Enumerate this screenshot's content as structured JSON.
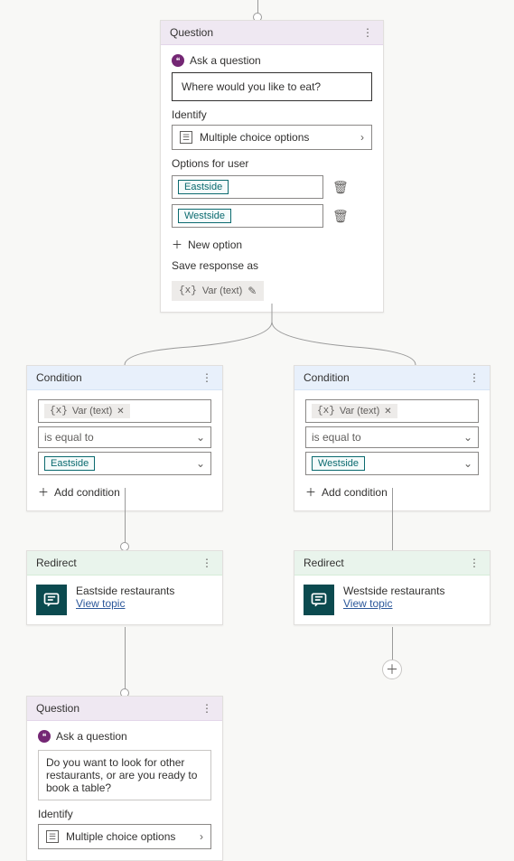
{
  "question1": {
    "header": "Question",
    "ask_label": "Ask a question",
    "prompt": "Where would you like to eat?",
    "identify_label": "Identify",
    "identify_value": "Multiple choice options",
    "options_label": "Options for user",
    "options": [
      "Eastside",
      "Westside"
    ],
    "new_option_label": "New option",
    "save_label": "Save response as",
    "save_var": "Var (text)"
  },
  "var_glyph": "{x}",
  "conditions": {
    "header": "Condition",
    "add_label": "Add condition",
    "operator": "is equal to",
    "var_label": "Var (text)",
    "left": {
      "value": "Eastside"
    },
    "right": {
      "value": "Westside"
    }
  },
  "redirects": {
    "header": "Redirect",
    "link_label": "View topic",
    "left": {
      "title": "Eastside restaurants"
    },
    "right": {
      "title": "Westside restaurants"
    }
  },
  "question2": {
    "header": "Question",
    "ask_label": "Ask a question",
    "prompt": "Do you want to look for other restaurants, or are you ready to book a table?",
    "identify_label": "Identify",
    "identify_value": "Multiple choice options"
  }
}
